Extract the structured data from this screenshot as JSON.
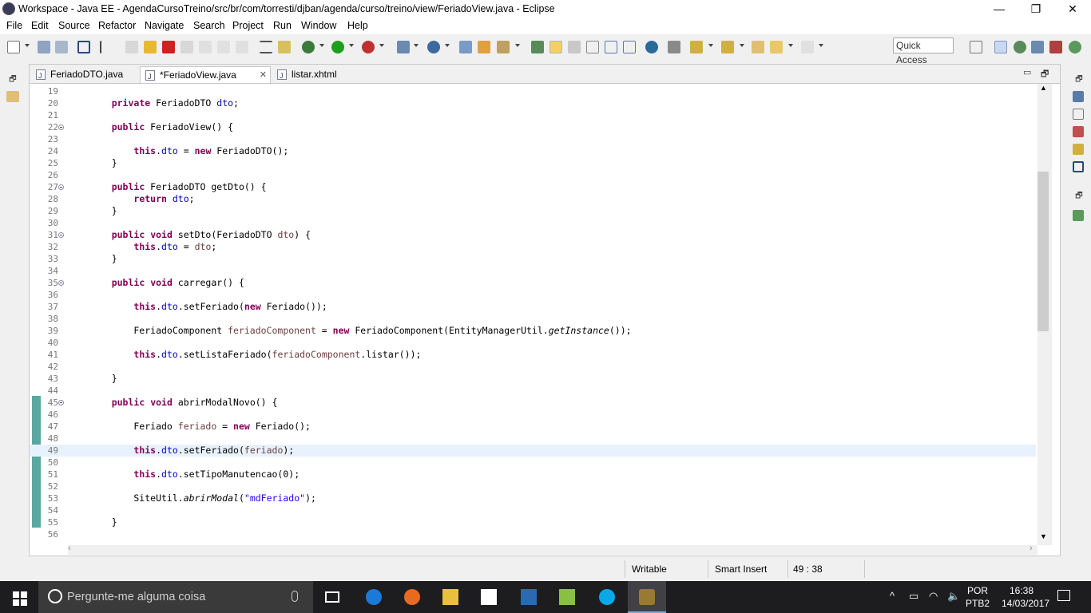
{
  "window": {
    "title": "Workspace - Java EE - AgendaCursoTreino/src/br/com/torresti/djban/agenda/curso/treino/view/FeriadoView.java - Eclipse",
    "minimize": "—",
    "maximize": "❐",
    "close": "✕"
  },
  "menu": [
    "File",
    "Edit",
    "Source",
    "Refactor",
    "Navigate",
    "Search",
    "Project",
    "Run",
    "Window",
    "Help"
  ],
  "toolbar": {
    "quick_access": "Quick Access"
  },
  "tabs": [
    {
      "label": "FeriadoDTO.java",
      "active": false
    },
    {
      "label": "*FeriadoView.java",
      "active": true,
      "close": "✕"
    },
    {
      "label": "listar.xhtml",
      "active": false
    }
  ],
  "tab_controls": {
    "minimize": "▭",
    "maximize": "🗗"
  },
  "editor": {
    "current_line": 49,
    "lines": [
      {
        "n": "19",
        "fold": false,
        "code": ""
      },
      {
        "n": "20",
        "fold": false,
        "code": "    <k>private</k> FeriadoDTO <f>dto</f>;"
      },
      {
        "n": "21",
        "fold": false,
        "code": ""
      },
      {
        "n": "22",
        "fold": true,
        "code": "    <k>public</k> FeriadoView() {"
      },
      {
        "n": "23",
        "fold": false,
        "code": ""
      },
      {
        "n": "24",
        "fold": false,
        "code": "        <k>this</k>.<f>dto</f> = <k>new</k> FeriadoDTO();"
      },
      {
        "n": "25",
        "fold": false,
        "code": "    }"
      },
      {
        "n": "26",
        "fold": false,
        "code": ""
      },
      {
        "n": "27",
        "fold": true,
        "code": "    <k>public</k> FeriadoDTO getDto() {"
      },
      {
        "n": "28",
        "fold": false,
        "code": "        <k>return</k> <f>dto</f>;"
      },
      {
        "n": "29",
        "fold": false,
        "code": "    }"
      },
      {
        "n": "30",
        "fold": false,
        "code": ""
      },
      {
        "n": "31",
        "fold": true,
        "code": "    <k>public</k> <k>void</k> setDto(FeriadoDTO <v>dto</v>) {"
      },
      {
        "n": "32",
        "fold": false,
        "code": "        <k>this</k>.<f>dto</f> = <v>dto</v>;"
      },
      {
        "n": "33",
        "fold": false,
        "code": "    }"
      },
      {
        "n": "34",
        "fold": false,
        "code": ""
      },
      {
        "n": "35",
        "fold": true,
        "code": "    <k>public</k> <k>void</k> carregar() {"
      },
      {
        "n": "36",
        "fold": false,
        "code": ""
      },
      {
        "n": "37",
        "fold": false,
        "code": "        <k>this</k>.<f>dto</f>.setFeriado(<k>new</k> Feriado());"
      },
      {
        "n": "38",
        "fold": false,
        "code": ""
      },
      {
        "n": "39",
        "fold": false,
        "code": "        FeriadoComponent <v>feriadoComponent</v> = <k>new</k> FeriadoComponent(EntityManagerUtil.<i>getInstance</i>());"
      },
      {
        "n": "40",
        "fold": false,
        "code": ""
      },
      {
        "n": "41",
        "fold": false,
        "code": "        <k>this</k>.<f>dto</f>.setListaFeriado(<v>feriadoComponent</v>.listar());"
      },
      {
        "n": "42",
        "fold": false,
        "code": ""
      },
      {
        "n": "43",
        "fold": false,
        "code": "    }"
      },
      {
        "n": "44",
        "fold": false,
        "code": ""
      },
      {
        "n": "45",
        "fold": true,
        "code": "    <k>public</k> <k>void</k> abrirModalNovo() {"
      },
      {
        "n": "46",
        "fold": false,
        "code": ""
      },
      {
        "n": "47",
        "fold": false,
        "code": "        Feriado <v>feriado</v> = <k>new</k> Feriado();"
      },
      {
        "n": "48",
        "fold": false,
        "code": ""
      },
      {
        "n": "49",
        "fold": false,
        "code": "        <k>this</k>.<f>dto</f>.setFeriado(<v>feriado</v>);"
      },
      {
        "n": "50",
        "fold": false,
        "code": ""
      },
      {
        "n": "51",
        "fold": false,
        "code": "        <k>this</k>.<f>dto</f>.setTipoManutencao(0);"
      },
      {
        "n": "52",
        "fold": false,
        "code": ""
      },
      {
        "n": "53",
        "fold": false,
        "code": "        SiteUtil.<i>abrirModal</i>(<s>\"mdFeriado\"</s>);"
      },
      {
        "n": "54",
        "fold": false,
        "code": ""
      },
      {
        "n": "55",
        "fold": false,
        "code": "    }"
      },
      {
        "n": "56",
        "fold": false,
        "code": ""
      }
    ]
  },
  "status": {
    "writable": "Writable",
    "insert_mode": "Smart Insert",
    "position": "49 : 38"
  },
  "taskbar": {
    "search_placeholder": "Pergunte-me alguma coisa",
    "language": "POR",
    "keyboard": "PTB2",
    "time": "16:38",
    "date": "14/03/2017"
  },
  "colors": {
    "keyword": "#7f0055",
    "field": "#0000c0",
    "local_var": "#6a3e3e",
    "string": "#2a00ff",
    "current_line": "#e8f2fe",
    "change_bar": "#5aa8a0"
  }
}
